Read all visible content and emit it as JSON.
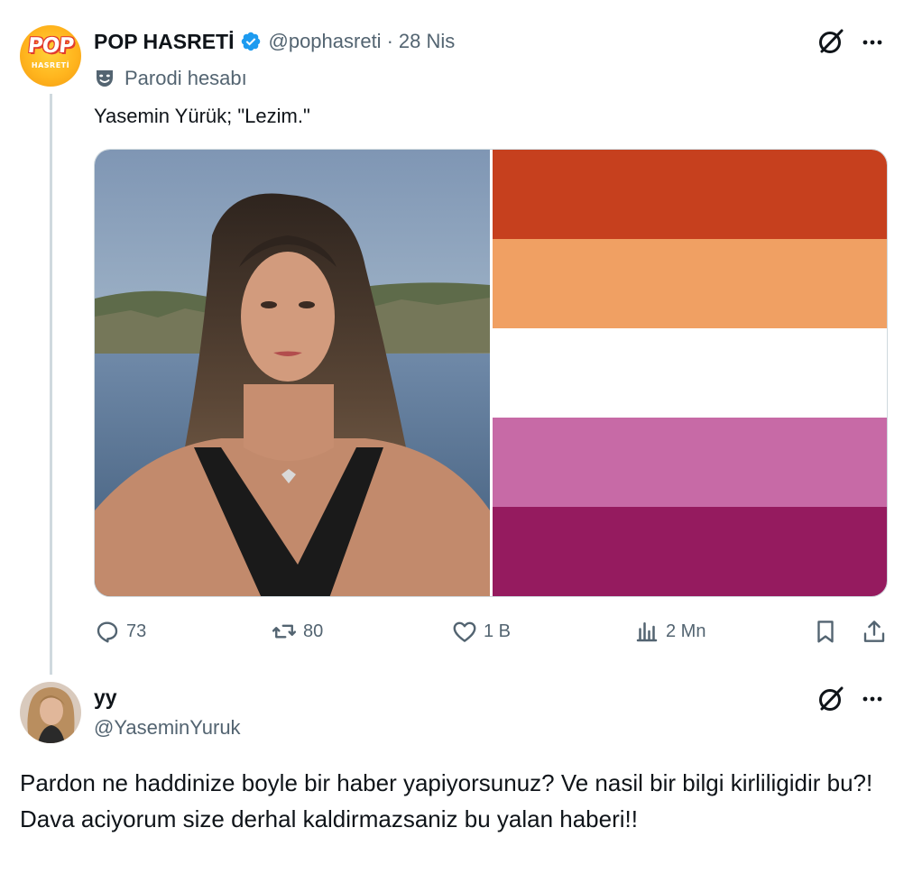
{
  "tweet": {
    "author": {
      "display_name": "POP HASRETİ",
      "handle": "@pophasreti",
      "avatar_text_top": "POP",
      "avatar_text_bottom": "HASRETİ",
      "verified": true
    },
    "separator": "·",
    "date": "28 Nis",
    "parody_label": "Parodi hesabı",
    "text": "Yasemin Yürük; \"Lezim.\"",
    "media": {
      "left_image": "portrait-photo",
      "right_image": "lesbian-pride-flag",
      "flag_colors": [
        "#c6401e",
        "#f0a063",
        "#ffffff",
        "#c76aa6",
        "#951b5f"
      ]
    },
    "stats": {
      "replies": "73",
      "reposts": "80",
      "likes": "1 B",
      "views": "2 Mn"
    }
  },
  "reply": {
    "display_name": "yy",
    "handle": "@YaseminYuruk",
    "text": "Pardon ne haddinize boyle bir haber yapiyorsunuz? Ve nasil bir bilgi kirliligidir bu?! Dava aciyorum size derhal kaldirmazsaniz bu yalan haberi!!"
  },
  "colors": {
    "text_primary": "#0f1419",
    "text_secondary": "#536471",
    "verified_blue": "#1d9bf0",
    "thread_line": "#cfd9de"
  },
  "icons": [
    "grok-icon",
    "more-icon",
    "parody-mask-icon",
    "verified-badge-icon",
    "reply-icon",
    "repost-icon",
    "like-icon",
    "views-icon",
    "bookmark-icon",
    "share-icon"
  ]
}
